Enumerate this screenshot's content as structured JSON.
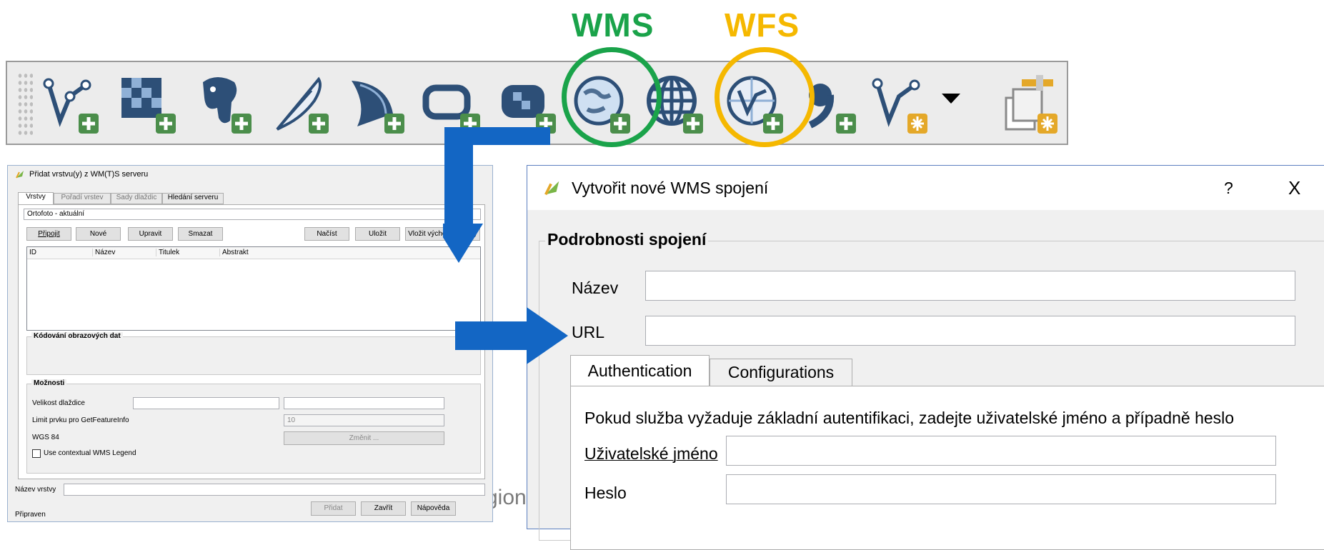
{
  "headers": {
    "wms": "WMS",
    "wfs": "WFS",
    "wms_color": "#1aa34a",
    "wfs_color": "#f5b800"
  },
  "toolbar": {
    "icons": [
      "add-vector-layer-icon",
      "add-raster-layer-icon",
      "add-postgis-layer-icon",
      "add-spatialite-layer-icon",
      "add-mssql-layer-icon",
      "add-oracle-layer-icon",
      "add-db2-layer-icon",
      "add-wms-layer-icon",
      "add-wcs-layer-icon",
      "add-wfs-layer-icon",
      "add-delimited-text-layer-icon",
      "new-shapefile-layer-icon",
      "dropdown-arrow-icon",
      "add-virtual-layer-icon"
    ]
  },
  "small_dialog": {
    "title": "Přidat vrstvu(y) z WM(T)S serveru",
    "help": "?",
    "tabs": [
      "Vrstvy",
      "Pořadí vrstev",
      "Sady dlaždic",
      "Hledání serveru"
    ],
    "connection_value": "Ortofoto - aktuální",
    "buttons": {
      "connect": "Připojit",
      "new": "Nové",
      "edit": "Upravit",
      "delete": "Smazat",
      "load": "Načíst",
      "save": "Uložit",
      "add_default": "Vložit výchozí servery"
    },
    "table_headers": [
      "ID",
      "Název",
      "Titulek",
      "Abstrakt"
    ],
    "encoding_group": "Kódování obrazových dat",
    "options_group": "Možnosti",
    "tile_size_label": "Velikost dlaždice",
    "feature_limit_label": "Limit prvku pro GetFeatureInfo",
    "feature_limit_value": "10",
    "crs_label": "WGS 84",
    "change_button": "Změnit ...",
    "legend_checkbox": "Use contextual WMS Legend",
    "layer_name_label": "Název vrstvy",
    "add_button": "Přidat",
    "close_button": "Zavřít",
    "help_button": "Nápověda",
    "status": "Připraven"
  },
  "big_dialog": {
    "title": "Vytvořit nové WMS spojení",
    "help": "?",
    "close": "X",
    "group_title": "Podrobnosti spojení",
    "name_label": "Název",
    "url_label": "URL",
    "tabs": [
      "Authentication",
      "Configurations"
    ],
    "auth_hint": "Pokud služba vyžaduje základní autentifikaci, zadejte uživatelské jméno a případně heslo",
    "username_label": "Uživatelské jméno",
    "password_label": "Heslo"
  },
  "background_text": "gion",
  "arrow_color": "#1366c4"
}
